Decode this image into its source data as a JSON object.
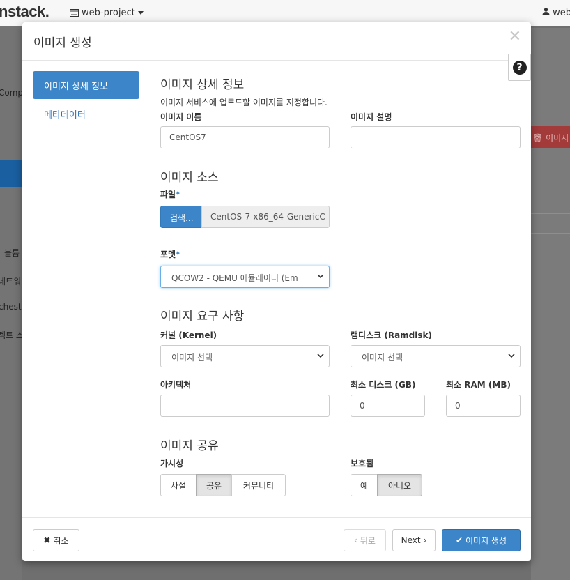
{
  "background": {
    "brand": "nstack.",
    "project": "web-project",
    "user": "web",
    "side_items": [
      "Compu",
      "볼륨",
      "네트워",
      "chestra",
      "젝트 스"
    ],
    "delete_button": "이미지"
  },
  "modal": {
    "title": "이미지 생성",
    "nav": {
      "active": "이미지 상세 정보",
      "item": "메타데이터"
    },
    "details": {
      "heading": "이미지 상세 정보",
      "help": "이미지 서비스에 업로드할 이미지를 지정합니다.",
      "name_label": "이미지 이름",
      "name_value": "CentOS7",
      "description_label": "이미지 설명",
      "description_value": ""
    },
    "source": {
      "heading": "이미지 소스",
      "file_label": "파일",
      "browse_button": "검색...",
      "file_name": "CentOS-7-x86_64-GenericC",
      "format_label": "포멧",
      "format_value": "QCOW2 - QEMU 에뮬레이터 (Em"
    },
    "requirements": {
      "heading": "이미지 요구 사항",
      "kernel_label": "커널 (Kernel)",
      "kernel_value": "이미지 선택",
      "ramdisk_label": "램디스크 (Ramdisk)",
      "ramdisk_value": "이미지 선택",
      "arch_label": "아키텍처",
      "arch_value": "",
      "min_disk_label": "최소 디스크 (GB)",
      "min_disk_value": "0",
      "min_ram_label": "최소 RAM (MB)",
      "min_ram_value": "0"
    },
    "sharing": {
      "heading": "이미지 공유",
      "visibility_label": "가시성",
      "visibility_options": [
        "사설",
        "공유",
        "커뮤니티"
      ],
      "visibility_selected": "공유",
      "protected_label": "보호됨",
      "protected_options": [
        "예",
        "아니오"
      ],
      "protected_selected": "아니오"
    },
    "footer": {
      "cancel": "취소",
      "back": "뒤로",
      "next": "Next",
      "create": "이미지 생성"
    }
  },
  "colors": {
    "primary": "#3b85c8",
    "required_mark": "#3b85c8",
    "overlay": "#6f6f6f"
  }
}
